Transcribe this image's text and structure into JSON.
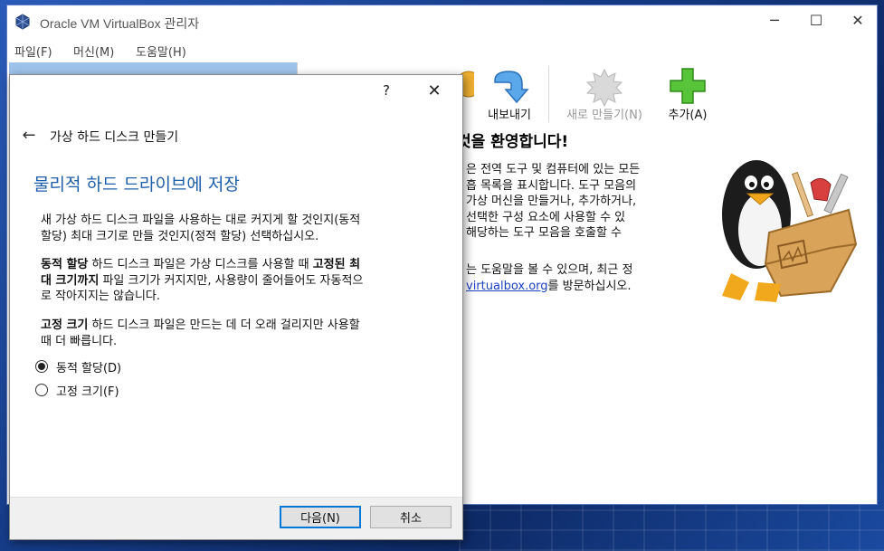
{
  "window": {
    "title": "Oracle VM VirtualBox 관리자",
    "min_glyph": "─",
    "max_glyph": "☐",
    "close_glyph": "✕"
  },
  "menu": [
    "파일(F)",
    "머신(M)",
    "도움말(H)"
  ],
  "toolbar": {
    "export_label": "내보내기",
    "new_label": "새로 만들기(N)",
    "add_label": "추가(A)"
  },
  "welcome": {
    "heading": "것을 환영합니다!",
    "para1": "은 전역 도구 및 컴퓨터에 있는 모든\n흡 목록을 표시합니다. 도구 모음의\n가상 머신을 만들거나, 추가하거나,\n선택한 구성 요소에 사용할 수 있\n해당하는 도구 모음을 호출할 수",
    "para2_a": "는 도움말을 볼 수 있으며, 최근 정",
    "para2_link": "virtualbox.org",
    "para2_b": "를 방문하십시오."
  },
  "dialog": {
    "help_glyph": "?",
    "close_glyph": "✕",
    "back_glyph": "←",
    "wizard_title": "가상 하드 디스크 만들기",
    "page_title": "물리적 하드 드라이브에 저장",
    "intro": "새 가상 하드 디스크 파일을 사용하는 대로 커지게 할 것인지(동적\n할당) 최대 크기로 만들 것인지(정적 할당) 선택하십시오.",
    "dynamic_bold": "동적 할당",
    "dynamic_mid": " 하드 디스크 파일은 가상 디스크를 사용할 때 ",
    "dynamic_bold2": "고정된 최\n대 크기까지",
    "dynamic_rest": " 파일 크기가 커지지만, 사용량이 줄어들어도 자동적으\n로 작아지지는 않습니다.",
    "fixed_bold": "고정 크기",
    "fixed_rest": " 하드 디스크 파일은 만드는 데 더 오래 걸리지만 사용할\n때 더 빠릅니다.",
    "option_dynamic": "동적 할당(D)",
    "option_fixed": "고정 크기(F)",
    "selected": "dynamic",
    "next_label": "다음(N)",
    "cancel_label": "취소"
  },
  "colors": {
    "accent_title": "#1f5ea8",
    "selection": "#9ec3ea",
    "default_button_border": "#0078d7"
  }
}
